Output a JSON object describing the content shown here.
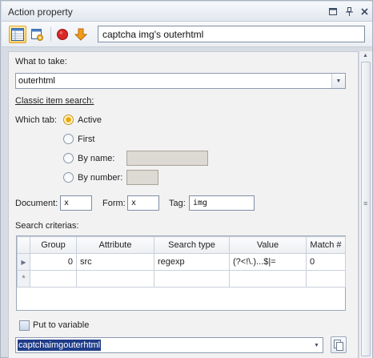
{
  "window": {
    "title": "Action property",
    "controls": {
      "dock_icon": "dock-window-icon",
      "pin_icon": "pin-icon",
      "close_icon": "close-icon"
    }
  },
  "toolbar": {
    "tools": [
      "properties-grid-icon",
      "settings-page-icon",
      "stop-red-icon",
      "move-down-orange-icon"
    ],
    "action_name": "captcha img's outerhtml"
  },
  "form": {
    "what_to_take_label": "What to take:",
    "what_to_take_value": "outerhtml",
    "classic_search_label": "Classic item search:",
    "which_tab_label": "Which tab:",
    "tab_options": {
      "active": "Active",
      "first": "First",
      "by_name": "By name:",
      "by_number": "By number:"
    },
    "selected_tab": "Active",
    "document_label": "Document:",
    "document_value": "x",
    "form_label": "Form:",
    "form_value": "x",
    "tag_label": "Tag:",
    "tag_value": "img",
    "search_criterias_label": "Search criterias:"
  },
  "grid": {
    "columns": [
      "Group",
      "Attribute",
      "Search type",
      "Value",
      "Match #"
    ],
    "rows": [
      {
        "group": "0",
        "attribute": "src",
        "search_type": "regexp",
        "value": "(?<!\\.)...$|=",
        "match": "0"
      }
    ],
    "new_row_marker": "*"
  },
  "variable": {
    "put_to_variable_label": "Put to variable",
    "variable_value": "captchaimgouterhtml",
    "checked": false
  },
  "colors": {
    "accent": "#f0a500",
    "selection": "#1f3c88",
    "title_bar": "#e3e8ef"
  }
}
